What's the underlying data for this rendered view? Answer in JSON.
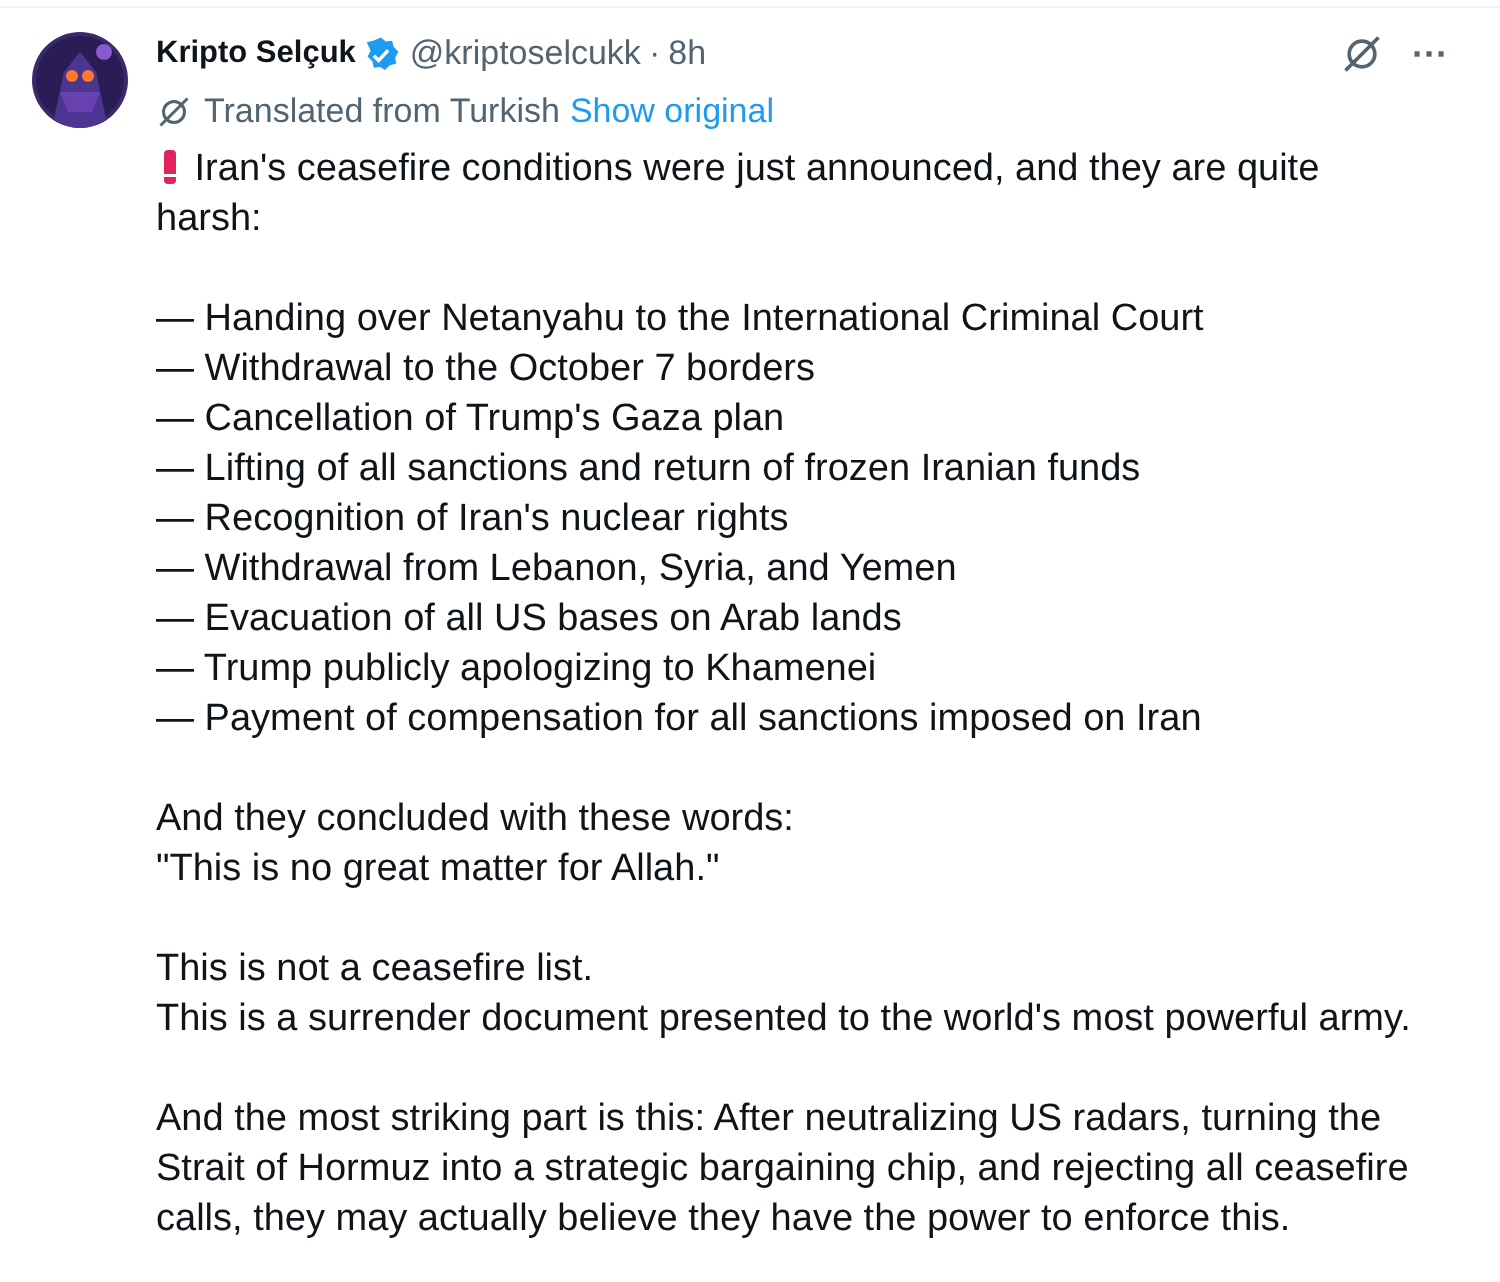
{
  "author": {
    "name": "Kripto Selçuk",
    "verified": true,
    "handle": "@kriptoselcukk",
    "separator": "·",
    "time": "8h"
  },
  "translation": {
    "label": "Translated from Turkish",
    "link": "Show original"
  },
  "more": "···",
  "body": [
    {
      "kind": "alert",
      "text": "Iran's ceasefire conditions were just announced, and they are quite harsh:"
    },
    {
      "kind": "list",
      "lines": [
        "— Handing over Netanyahu to the International Criminal Court",
        "— Withdrawal to the October 7 borders",
        "— Cancellation of Trump's Gaza plan",
        "— Lifting of all sanctions and return of frozen Iranian funds",
        "— Recognition of Iran's nuclear rights",
        "— Withdrawal from Lebanon, Syria, and Yemen",
        "— Evacuation of all US bases on Arab lands",
        "— Trump publicly apologizing to Khamenei",
        "— Payment of compensation for all sanctions imposed on Iran"
      ]
    },
    {
      "kind": "list",
      "lines": [
        "And they concluded with these words:",
        "\"This is no great matter for Allah.\""
      ]
    },
    {
      "kind": "list",
      "lines": [
        "This is not a ceasefire list.",
        "This is a surrender document presented to the world's most powerful army."
      ]
    },
    {
      "kind": "text",
      "text": "And the most striking part is this: After neutralizing US radars, turning the Strait of Hormuz into a strategic bargaining chip, and rejecting all ceasefire calls, they may actually believe they have the power to enforce this."
    }
  ]
}
